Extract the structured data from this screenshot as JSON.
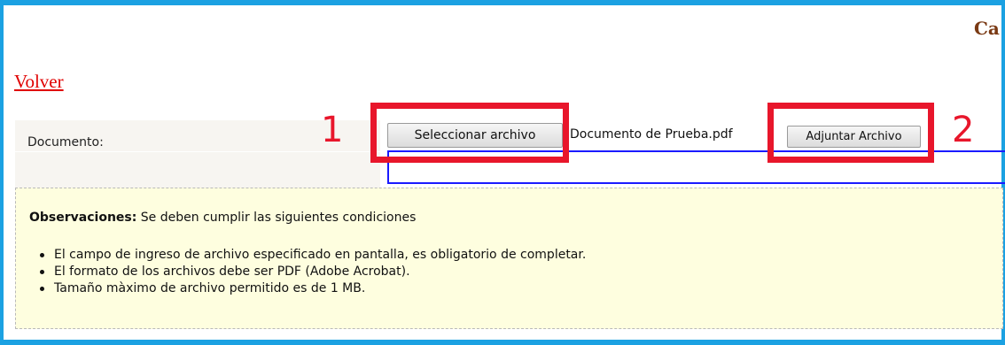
{
  "header": {
    "title_fragment": "Ca"
  },
  "nav": {
    "back_label": "Volver"
  },
  "form": {
    "document_label": "Documento:",
    "select_button_label": "Seleccionar archivo",
    "selected_file": "Documento de Prueba.pdf",
    "attach_button_label": "Adjuntar Archivo"
  },
  "annotations": {
    "step1": "1",
    "step2": "2",
    "highlight_color": "#e8162b"
  },
  "observations": {
    "heading": "Observaciones:",
    "intro": " Se deben cumplir las siguientes condiciones",
    "items": [
      "El campo de ingreso de archivo especificado en pantalla, es obligatorio de completar.",
      "El formato de los archivos debe ser PDF (Adobe Acrobat).",
      "Tamaño màximo de archivo permitido es de 1 MB."
    ]
  },
  "colors": {
    "frame": "#1ba1e2",
    "link": "#e00000",
    "observations_bg": "#fefedf",
    "file_box_border": "#1a1aff"
  }
}
